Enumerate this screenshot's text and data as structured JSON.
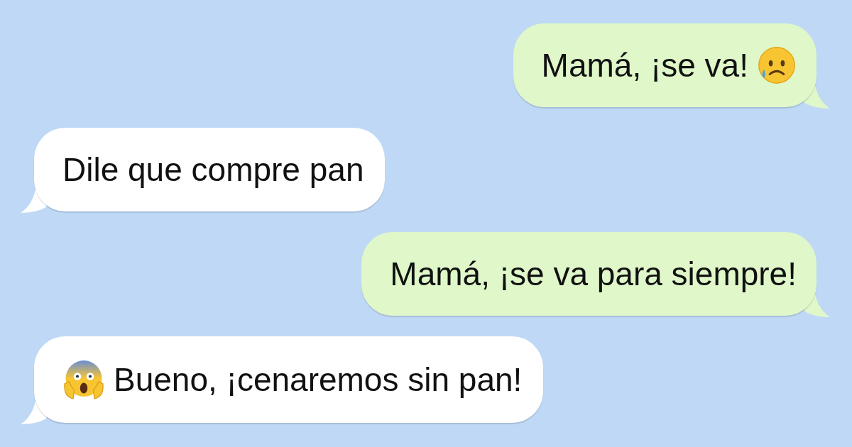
{
  "messages": [
    {
      "kind": "outgoing",
      "parts": [
        {
          "kind": "text",
          "text": "Mamá, ¡se va!"
        },
        {
          "kind": "sad_emoji"
        }
      ]
    },
    {
      "kind": "incoming",
      "parts": [
        {
          "kind": "text",
          "text": "Dile que compre pan"
        }
      ]
    },
    {
      "kind": "outgoing",
      "parts": [
        {
          "kind": "text",
          "text": "Mamá, ¡se va para siempre!"
        }
      ]
    },
    {
      "kind": "incoming",
      "parts": [
        {
          "kind": "scream_emoji"
        },
        {
          "kind": "text",
          "text": "Bueno, ¡cenaremos sin pan!"
        }
      ]
    }
  ]
}
